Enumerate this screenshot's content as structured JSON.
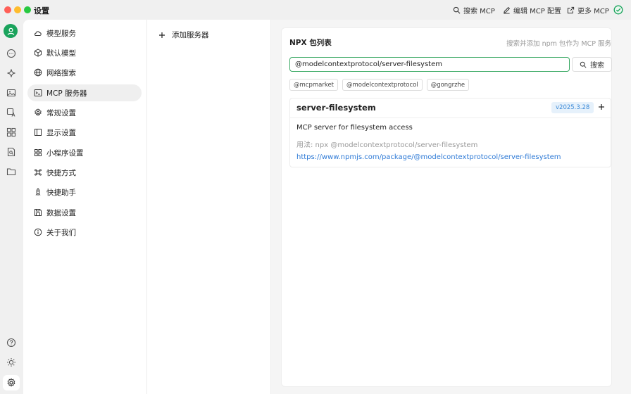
{
  "window": {
    "title": "设置"
  },
  "top_actions": {
    "search_mcp": "搜索 MCP",
    "edit_mcp": "编辑 MCP 配置",
    "more_mcp": "更多 MCP"
  },
  "sidebar": {
    "items": [
      {
        "label": "模型服务",
        "icon": "cloud-icon"
      },
      {
        "label": "默认模型",
        "icon": "cube-icon"
      },
      {
        "label": "网络搜索",
        "icon": "globe-icon"
      },
      {
        "label": "MCP 服务器",
        "icon": "terminal-icon",
        "active": true
      },
      {
        "label": "常规设置",
        "icon": "gear-icon"
      },
      {
        "label": "显示设置",
        "icon": "layout-icon"
      },
      {
        "label": "小程序设置",
        "icon": "grid-icon"
      },
      {
        "label": "快捷方式",
        "icon": "command-icon"
      },
      {
        "label": "快捷助手",
        "icon": "rocket-icon"
      },
      {
        "label": "数据设置",
        "icon": "save-icon"
      },
      {
        "label": "关于我们",
        "icon": "info-icon"
      }
    ]
  },
  "servers": {
    "add_label": "添加服务器"
  },
  "npx": {
    "title": "NPX 包列表",
    "hint": "搜索并添加 npm 包作为 MCP 服务",
    "search_value": "@modelcontextprotocol/server-filesystem",
    "search_button": "搜索",
    "chips": [
      "@mcpmarket",
      "@modelcontextprotocol",
      "@gongrzhe"
    ],
    "result": {
      "name": "server-filesystem",
      "version": "v2025.3.28",
      "description": "MCP server for filesystem access",
      "usage": "用法: npx @modelcontextprotocol/server-filesystem",
      "url": "https://www.npmjs.com/package/@modelcontextprotocol/server-filesystem"
    }
  },
  "colors": {
    "accent": "#1aa35c",
    "link": "#2e7ad6",
    "version_bg": "#e6f1fb"
  }
}
